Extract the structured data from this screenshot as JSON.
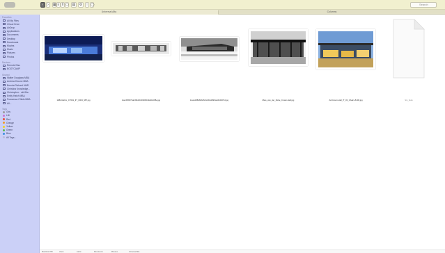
{
  "window": {
    "toolbar": {
      "nav_icons": [
        "back-icon",
        "forward-icon"
      ],
      "view_buttons": [
        "icon-view-icon",
        "list-view-icon",
        "column-view-icon",
        "gallery-view-icon"
      ],
      "arrange_icon": "arrange-icon",
      "action_icon": "gear-icon",
      "share_icon": "share-icon",
      "tag_icon": "tag-icon",
      "search_placeholder": "Search"
    },
    "tabs": [
      {
        "label": "Universal Alta",
        "active": true
      },
      {
        "label": "Columns",
        "active": false
      }
    ]
  },
  "sidebar": {
    "sections": [
      {
        "heading": "Favorites",
        "items": [
          {
            "label": "All My Files",
            "icon": "all-files-icon"
          },
          {
            "label": "iCloud Drive",
            "icon": "cloud-icon"
          },
          {
            "label": "AirDrop",
            "icon": "airdrop-icon"
          },
          {
            "label": "Applications",
            "icon": "applications-icon"
          },
          {
            "label": "Documents",
            "icon": "documents-icon"
          },
          {
            "label": "Desktop",
            "icon": "desktop-icon"
          },
          {
            "label": "Downloads",
            "icon": "downloads-icon"
          },
          {
            "label": "Movies",
            "icon": "movies-icon"
          },
          {
            "label": "Music",
            "icon": "music-icon"
          },
          {
            "label": "Pictures",
            "icon": "pictures-icon"
          },
          {
            "label": "Photos",
            "icon": "photos-icon"
          }
        ]
      },
      {
        "heading": "Devices",
        "items": [
          {
            "label": "Remote Disc",
            "icon": "disc-icon"
          },
          {
            "label": "BOOTCAMP",
            "icon": "drive-icon"
          }
        ]
      },
      {
        "heading": "Shared",
        "items": [
          {
            "label": "Walter Douglass MBA",
            "icon": "computer-icon"
          },
          {
            "label": "Andrew Dioone MBA",
            "icon": "computer-icon"
          },
          {
            "label": "Brenda Richard MAR",
            "icon": "computer-icon"
          },
          {
            "label": "Christina Knowledge...",
            "icon": "computer-icon"
          },
          {
            "label": "Christopher - old iMa",
            "icon": "computer-icon"
          },
          {
            "label": "Emily Hatch MBA",
            "icon": "computer-icon"
          },
          {
            "label": "Francesca Childs MBA",
            "icon": "computer-icon"
          },
          {
            "label": "All...",
            "icon": "globe-icon"
          }
        ]
      },
      {
        "heading": "Tags",
        "items": [
          {
            "label": "Gris",
            "color": "#9a9a9a"
          },
          {
            "label": "Lilli",
            "color": "#c873d6"
          },
          {
            "label": "Red",
            "color": "#e94b3c"
          },
          {
            "label": "Orange",
            "color": "#f29a26"
          },
          {
            "label": "Yellow",
            "color": "#f2d41f"
          },
          {
            "label": "Green",
            "color": "#5ab552"
          },
          {
            "label": "Blue",
            "color": "#3a8fe0"
          },
          {
            "label": "All Tags...",
            "color": "#b9bcd9"
          }
        ]
      }
    ]
  },
  "files": [
    {
      "name": "1982.Mehm_CT091_IIT_0003_987.jpg",
      "kind": "photo"
    },
    {
      "name": "1/as/bfff2f73ab/b8d1b60b6f4bbfab6c0f8e.jpg",
      "kind": "photo"
    },
    {
      "name": "1/as/d4f8d60b/8c0c2b0d26b6a1bb0b07d.jpg",
      "kind": "photo"
    },
    {
      "name": "Mies_van_der_Rohe_Crown-Hall.jpg",
      "kind": "photo"
    },
    {
      "name": "ArcCrown-Hall_IT_03_Chairs-5100.jpg",
      "kind": "photo"
    },
    {
      "name": "Sin_titulo",
      "kind": "document"
    }
  ],
  "path_bar": [
    "Macintosh HD",
    "Users",
    "carlos",
    "Documents",
    "Pictures",
    "Universal Alta"
  ]
}
